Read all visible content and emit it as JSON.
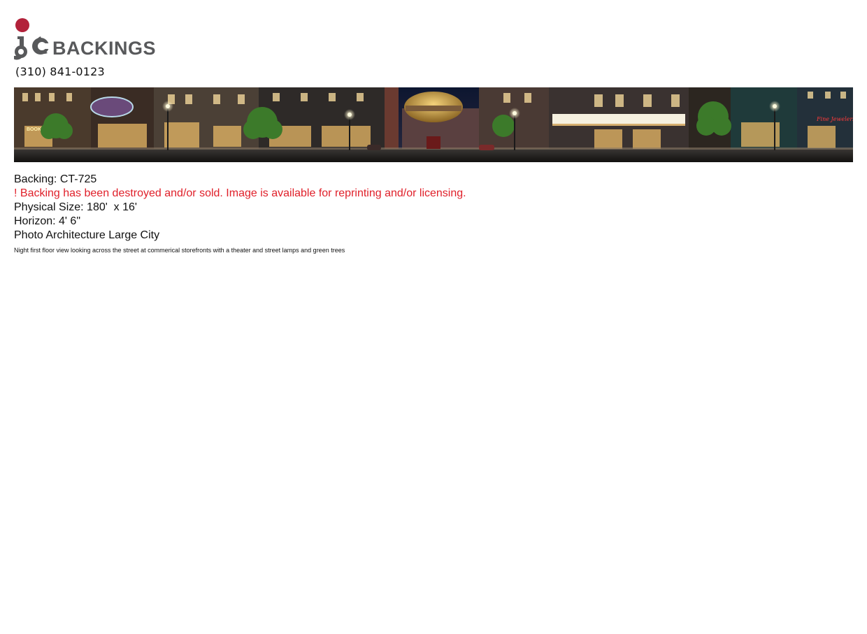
{
  "header": {
    "logo_name": "jc-backings-logo",
    "logo_text": "BACKINGS",
    "logo_colors": {
      "dot": "#b2213a",
      "mark": "#58595b",
      "text": "#58595b"
    },
    "phone": "(310) 841-0123"
  },
  "banner": {
    "description": "panoramic night city street backing image"
  },
  "details": {
    "backing_line": "Backing: CT-725",
    "warning_line": "! Backing has been destroyed and/or sold. Image is available for reprinting and/or licensing.",
    "size_line": "Physical Size: 180'  x 16'",
    "horizon_line": "Horizon: 4' 6\"",
    "category_line": "Photo Architecture Large City",
    "caption": "Night first floor view looking across the street at commerical storefronts with a theater and street lamps and green trees"
  },
  "colors": {
    "warning": "#e0202a"
  }
}
